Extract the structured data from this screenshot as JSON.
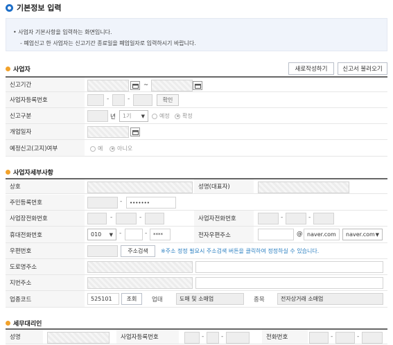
{
  "page_title": "기본정보 입력",
  "info": {
    "line1": "• 사업자 기본사항을 입력하는 화면입니다.",
    "line2": "- 폐업신고 한 사업자는 신고기간 종료일을 폐업일자로 입력하시기 바랍니다."
  },
  "section_business": {
    "title": "사업자",
    "new_button": "새로작성하기",
    "load_button": "신고서 불러오기",
    "labels": {
      "period": "신고기간",
      "brn": "사업자등록번호",
      "category": "신고구분",
      "open_date": "개업일자",
      "estimate": "예정신고(고지)여부"
    },
    "tilde": "~",
    "confirm_button": "확인",
    "year_suffix": "년",
    "term_select": "1기",
    "radio_estimate": "예정",
    "radio_final": "확정",
    "radio_yes": "예",
    "radio_no": "아니오"
  },
  "section_detail": {
    "title": "사업자세부사항",
    "labels": {
      "company": "상호",
      "ceo": "성명(대표자)",
      "rrn": "주민등록번호",
      "biz_phone": "사업장전화번호",
      "owner_phone": "사업자전화번호",
      "mobile": "휴대전화번호",
      "email": "전자우편주소",
      "zip": "우편번호",
      "road_addr": "도로명주소",
      "lot_addr": "지번주소",
      "industry": "업종코드",
      "business_type": "업태",
      "item": "종목"
    },
    "rrn_masked": "•••••••",
    "mobile_prefix": "010",
    "mobile_masked": "****",
    "email_at": "@",
    "email_domain": "naver.com",
    "email_select": "naver.com",
    "addr_search_button": "주소검색",
    "addr_notice": "※주소 정정 필요시 주소검색 버튼을 클릭하여 정정하실 수 있습니다.",
    "industry_code": "525101",
    "lookup_button": "조회",
    "business_type_value": "도매 및 소매업",
    "item_value": "전자상거래 소매업"
  },
  "section_tax": {
    "title": "세무대리인",
    "labels": {
      "name": "성명",
      "brn": "사업자등록번호",
      "phone": "전화번호"
    }
  },
  "colors": {
    "title_icon": "#1e6fc8",
    "section_icon": "#f2a22b",
    "notice_text": "#2a7fc1",
    "info_bg": "#f0f4fb"
  }
}
